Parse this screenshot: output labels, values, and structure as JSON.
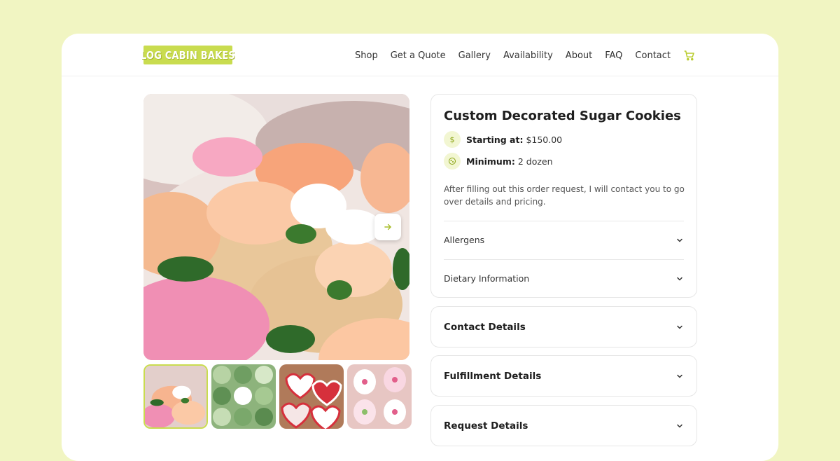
{
  "brand": {
    "logo_text": "LOG CABIN BAKES",
    "accent": "#c9dc4f",
    "background": "#f1f5c2"
  },
  "nav": {
    "items": [
      "Shop",
      "Get a Quote",
      "Gallery",
      "Availability",
      "About",
      "FAQ",
      "Contact"
    ],
    "cart_icon": "cart-icon"
  },
  "gallery": {
    "thumbnails": [
      "thumbnail-1",
      "thumbnail-2",
      "thumbnail-3",
      "thumbnail-4"
    ],
    "active_index": 0,
    "next_icon": "arrow-right-icon"
  },
  "product": {
    "title": "Custom Decorated Sugar Cookies",
    "price_label": "Starting at:",
    "price_value": "$150.00",
    "price_icon": "dollar-icon",
    "minimum_label": "Minimum:",
    "minimum_value": "2 dozen",
    "minimum_icon": "cookie-icon",
    "description": "After filling out this order request, I will contact you to go over details and pricing.",
    "accordions": [
      "Allergens",
      "Dietary Information"
    ]
  },
  "sections": [
    "Contact Details",
    "Fulfillment Details",
    "Request Details"
  ]
}
